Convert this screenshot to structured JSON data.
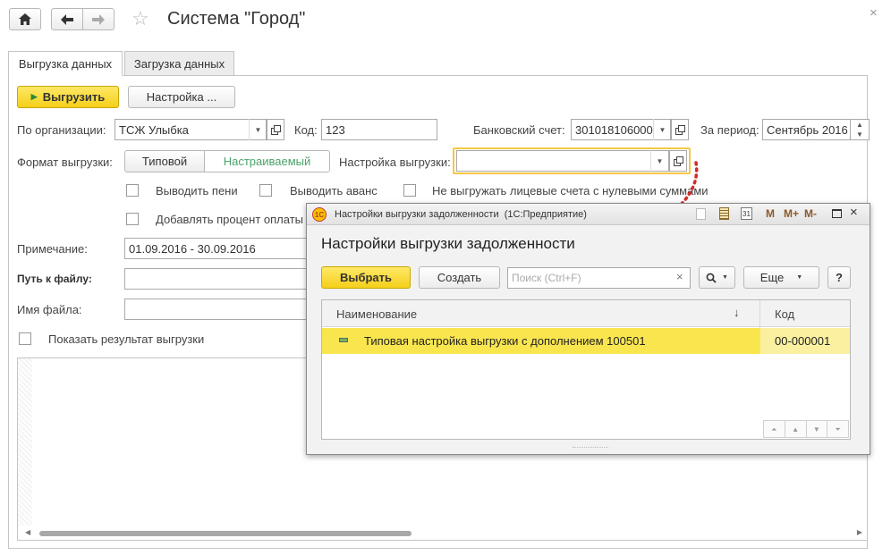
{
  "header": {
    "title": "Система \"Город\""
  },
  "tabs": [
    {
      "label": "Выгрузка данных"
    },
    {
      "label": "Загрузка данных"
    }
  ],
  "toolbar": {
    "export_label": "Выгрузить",
    "settings_label": "Настройка ..."
  },
  "form": {
    "org_label": "По организации:",
    "org_value": "ТСЖ Улыбка",
    "code_label": "Код:",
    "code_value": "123",
    "bank_label": "Банковский счет:",
    "bank_value": "301018106000",
    "period_label": "За период:",
    "period_value": "Сентябрь 2016",
    "format_label": "Формат выгрузки:",
    "format_options": [
      "Типовой",
      "Настраиваемый"
    ],
    "export_settings_label": "Настройка выгрузки:",
    "export_settings_value": "",
    "checkboxes": [
      {
        "label": "Выводить пени"
      },
      {
        "label": "Выводить аванс"
      },
      {
        "label": "Не выгружать лицевые счета с нулевыми суммами"
      },
      {
        "label": "Добавлять процент оплаты б"
      }
    ],
    "note_label": "Примечание:",
    "note_value": "01.09.2016 - 30.09.2016",
    "path_label": "Путь к файлу:",
    "filename_label": "Имя файла:",
    "show_result_label": "Показать результат выгрузки"
  },
  "dialog": {
    "window_title": "Настройки выгрузки задолженности  (1С:Предприятие)",
    "titlebar_icons": [
      "M",
      "M+",
      "M-"
    ],
    "heading": "Настройки выгрузки задолженности",
    "select_label": "Выбрать",
    "create_label": "Создать",
    "search_placeholder": "Поиск (Ctrl+F)",
    "more_label": "Еще",
    "help_label": "?",
    "columns": [
      "Наименование",
      "Код"
    ],
    "sort_indicator": "↓",
    "rows": [
      {
        "name": "Типовая настройка выгрузки с дополнением 100501",
        "code": "00-000001"
      }
    ]
  },
  "colors": {
    "accent_yellow": "#f5cf1a",
    "selected_row": "#f9e64f",
    "arrow_red": "#d42a2a",
    "active_green": "#4aa36b"
  }
}
